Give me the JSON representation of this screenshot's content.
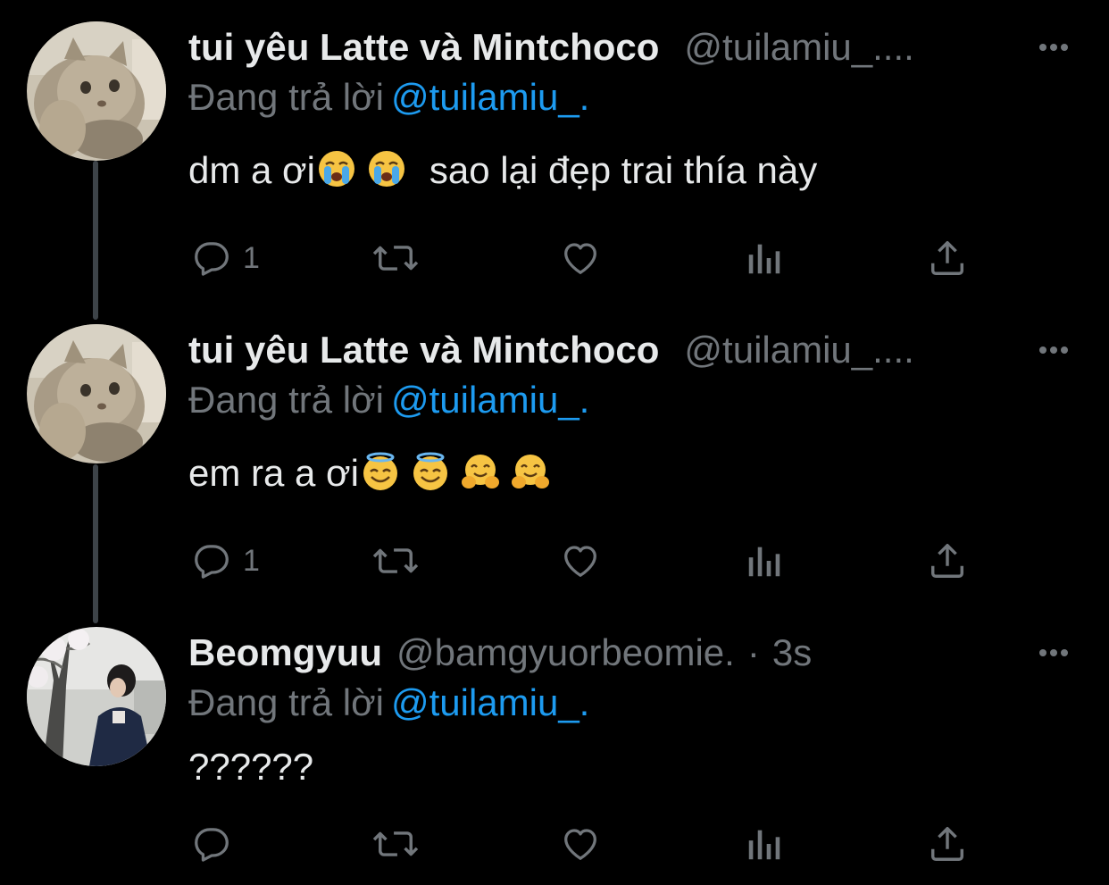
{
  "colors": {
    "background": "#000000",
    "primary_text": "#e7e9ea",
    "secondary_text": "#71767b",
    "mention": "#1d9bf0",
    "thread_line": "#3d4348"
  },
  "icons": {
    "more": "more-horizontal-icon",
    "reply": "reply-bubble-icon",
    "retweet": "retweet-icon",
    "like": "heart-icon",
    "views": "analytics-bars-icon",
    "share": "share-upload-icon"
  },
  "tweets": [
    {
      "display_name": "tui yêu Latte và Mintchoco",
      "handle": "@tuilamiu_....",
      "reply_label": "Đang trả lời",
      "reply_mention": "@tuilamiu_.",
      "text": "dm a ơi",
      "text_after": "sao lại đẹp trai thía này",
      "emojis": [
        "crying-face-emoji",
        "crying-face-emoji"
      ],
      "reply_count": "1",
      "avatar": "cat-avatar"
    },
    {
      "display_name": "tui yêu Latte và Mintchoco",
      "handle": "@tuilamiu_....",
      "reply_label": "Đang trả lời",
      "reply_mention": "@tuilamiu_.",
      "text": "em ra a ơi",
      "emojis": [
        "halo-face-emoji",
        "halo-face-emoji",
        "hugging-face-emoji",
        "hugging-face-emoji"
      ],
      "reply_count": "1",
      "avatar": "cat-avatar"
    },
    {
      "display_name": "Beomgyuu",
      "handle": "@bamgyuorbeomie.",
      "separator": "·",
      "time": "3s",
      "reply_label": "Đang trả lời",
      "reply_mention": "@tuilamiu_.",
      "text": "??????",
      "reply_count": "",
      "avatar": "person-tree-avatar"
    }
  ]
}
